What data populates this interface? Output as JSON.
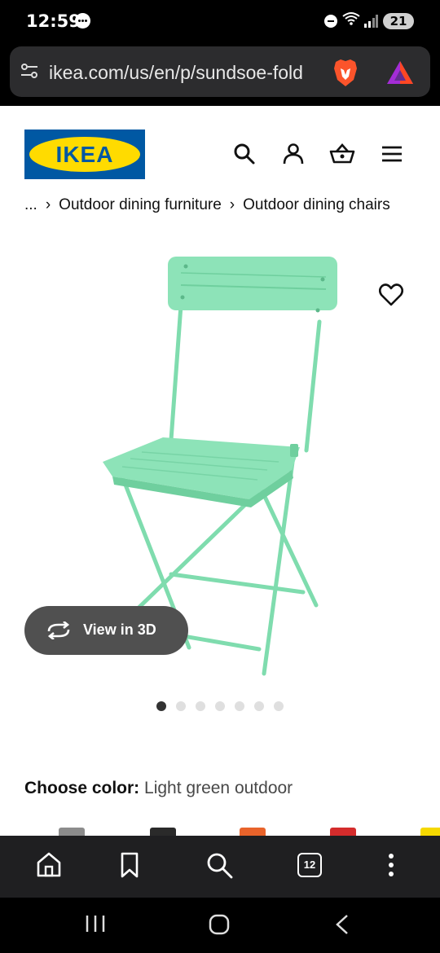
{
  "status_bar": {
    "time": "12:59",
    "battery": "21"
  },
  "browser": {
    "url": "ikea.com/us/en/p/sundsoe-fold"
  },
  "header": {
    "logo_text": "IKEA"
  },
  "breadcrumb": {
    "ellipsis": "...",
    "items": [
      "Outdoor dining furniture",
      "Outdoor dining chairs"
    ]
  },
  "product": {
    "view3d_label": "View in 3D",
    "gallery_count": 7,
    "gallery_active_index": 0,
    "color_label": "Choose color:",
    "color_value": "Light green outdoor"
  },
  "colors": {
    "chair": "#8de3b8",
    "chair_dark": "#6fcf9e",
    "brand_blue": "#0058a3",
    "brand_yellow": "#ffdb00",
    "swatches": [
      "#8c8c8c",
      "#2a2a2a",
      "#e8632b",
      "#d42c2c",
      "#f5d800"
    ]
  },
  "bottom_nav": {
    "tab_count": "12"
  }
}
